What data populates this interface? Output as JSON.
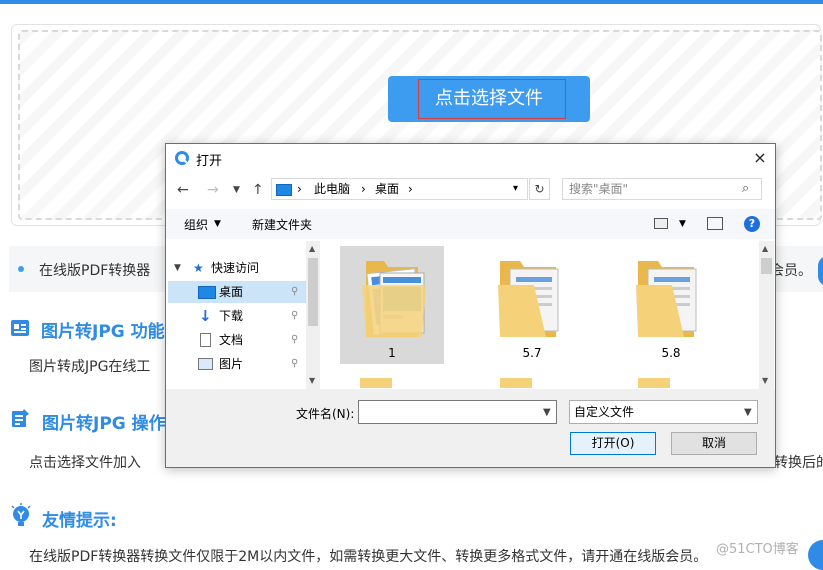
{
  "page": {
    "choose_button": "点击选择文件",
    "info_text": "在线版PDF转换器",
    "info_tail": "会员。",
    "section1_title": "图片转JPG 功能",
    "section1_text": "图片转成JPG在线工",
    "section2_title": "图片转JPG 操作",
    "section2_text": "点击选择文件加入",
    "section2_tail": "转换后的",
    "section3_title": "友情提示:",
    "section3_text": "在线版PDF转换器转换文件仅限于2M以内文件，如需转换更大文件、转换更多格式文件，请开通在线版会员。",
    "watermark": "@51CTO博客",
    "accent_color": "#2f8be6"
  },
  "dialog": {
    "title": "打开",
    "close_icon": "×",
    "address": {
      "root": "此电脑",
      "current": "桌面"
    },
    "search_placeholder": "搜索\"桌面\"",
    "toolbar": {
      "organize": "组织",
      "new_folder": "新建文件夹"
    },
    "tree": [
      {
        "label": "快速访问",
        "icon": "star-icon"
      },
      {
        "label": "桌面",
        "icon": "desktop-icon",
        "selected": true
      },
      {
        "label": "下载",
        "icon": "download-icon"
      },
      {
        "label": "文档",
        "icon": "document-icon"
      },
      {
        "label": "图片",
        "icon": "picture-icon"
      }
    ],
    "files": [
      {
        "label": "1",
        "selected": true
      },
      {
        "label": "5.7"
      },
      {
        "label": "5.8"
      }
    ],
    "filename_label": "文件名(N):",
    "filename_value": "",
    "filetype_value": "自定义文件",
    "open_button": "打开(O)",
    "cancel_button": "取消"
  }
}
